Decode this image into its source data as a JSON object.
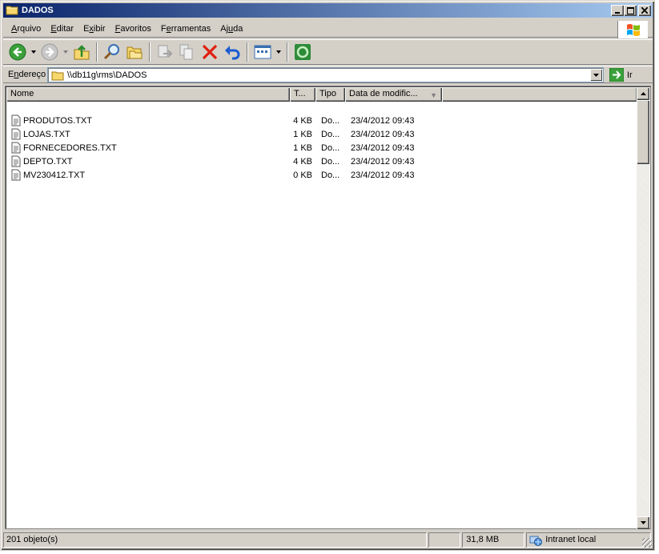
{
  "window": {
    "title": "DADOS"
  },
  "title_buttons": {
    "minimize": "_",
    "maximize": "□",
    "close": "✕"
  },
  "menu": {
    "items": [
      {
        "label": "Arquivo",
        "accel": "A",
        "rest": "rquivo"
      },
      {
        "label": "Editar",
        "accel": "E",
        "rest": "ditar",
        "pre": ""
      },
      {
        "label": "Exibir",
        "pre": "E",
        "accel": "x",
        "rest": "ibir"
      },
      {
        "label": "Favoritos",
        "accel": "F",
        "rest": "avoritos"
      },
      {
        "label": "Ferramentas",
        "pre": "F",
        "accel": "e",
        "rest": "rramentas"
      },
      {
        "label": "Ajuda",
        "pre": "Aj",
        "accel": "u",
        "rest": "da"
      }
    ]
  },
  "toolbar": {
    "icons": [
      "back-icon",
      "forward-icon",
      "up-folder-icon",
      "search-icon",
      "folders-icon",
      "move-to-icon",
      "copy-to-icon",
      "delete-icon",
      "undo-icon",
      "views-icon",
      "sync-icon"
    ]
  },
  "address": {
    "label_pre": "E",
    "label_accel": "n",
    "label_rest": "dereço",
    "path": "\\\\db11g\\rms\\DADOS",
    "go_label": "Ir"
  },
  "columns": {
    "name": "Nome",
    "size": "T...",
    "type": "Tipo",
    "date": "Data de modific..."
  },
  "files": [
    {
      "name": "PRODUTOS.TXT",
      "size": "4 KB",
      "type": "Do...",
      "date": "23/4/2012 09:43"
    },
    {
      "name": "LOJAS.TXT",
      "size": "1 KB",
      "type": "Do...",
      "date": "23/4/2012 09:43"
    },
    {
      "name": "FORNECEDORES.TXT",
      "size": "1 KB",
      "type": "Do...",
      "date": "23/4/2012 09:43"
    },
    {
      "name": "DEPTO.TXT",
      "size": "4 KB",
      "type": "Do...",
      "date": "23/4/2012 09:43"
    },
    {
      "name": "MV230412.TXT",
      "size": "0 KB",
      "type": "Do...",
      "date": "23/4/2012 09:43"
    }
  ],
  "status": {
    "objects": "201 objeto(s)",
    "size": "31,8 MB",
    "zone": "Intranet local"
  },
  "colors": {
    "title_start": "#0a246a",
    "title_end": "#a6caf0",
    "face": "#d4d0c8"
  }
}
